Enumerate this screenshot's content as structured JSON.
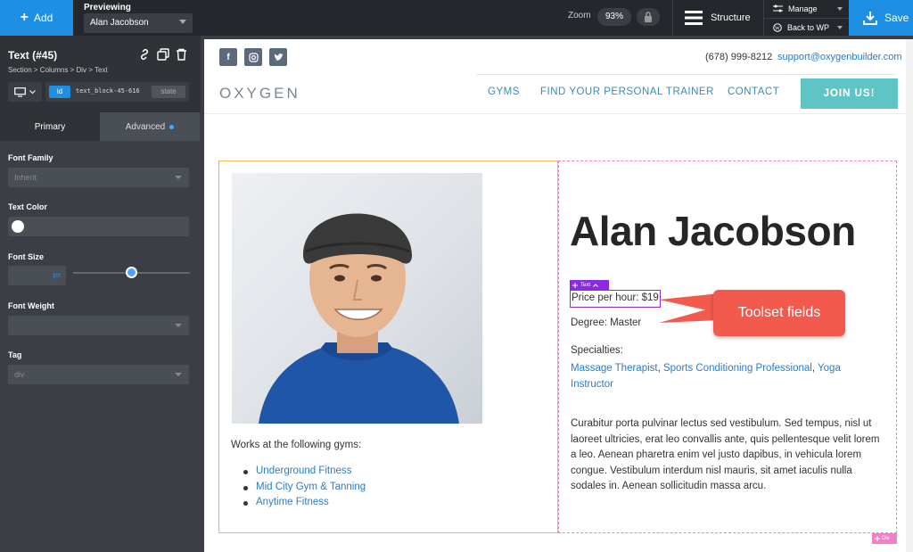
{
  "topbar": {
    "add_label": "Add",
    "previewing_label": "Previewing",
    "previewing_value": "Alan Jacobson",
    "zoom_label": "Zoom",
    "zoom_value": "93%",
    "structure_label": "Structure",
    "manage_label": "Manage",
    "back_label": "Back to WP",
    "save_label": "Save"
  },
  "panel": {
    "element_title": "Text (#45)",
    "breadcrumb": "Section > Columns > Div > Text",
    "id_pill": "id",
    "id_value": "text_block-45-616",
    "state_label": "state",
    "tabs": [
      {
        "label": "Primary"
      },
      {
        "label": "Advanced"
      }
    ],
    "fields": {
      "font_family_label": "Font Family",
      "font_family_value": "Inherit",
      "text_color_label": "Text Color",
      "font_size_label": "Font Size",
      "font_size_unit": "px",
      "font_weight_label": "Font Weight",
      "tag_label": "Tag",
      "tag_value": "div"
    }
  },
  "site": {
    "phone": "(678) 999-8212",
    "email": "support@oxygenbuilder.com",
    "logo": "OXYGEN",
    "nav": [
      "GYMS",
      "FIND YOUR PERSONAL TRAINER",
      "CONTACT"
    ],
    "join_label": "JOIN US!",
    "social": [
      "facebook-icon",
      "instagram-icon",
      "twitter-icon"
    ]
  },
  "profile": {
    "name": "Alan Jacobson",
    "text_tag": "Text",
    "price": "Price per hour: $19",
    "degree": "Degree: Master",
    "specialties_label": "Specialties:",
    "specialties": [
      "Massage Therapist",
      "Sports Conditioning Professional",
      "Yoga Instructor"
    ],
    "bio": "Curabitur porta pulvinar lectus sed vestibulum. Sed tempus, nisl ut laoreet ultricies, erat leo convallis ante, quis pellentesque velit lorem a leo. Aenean pharetra enim vel justo dapibus, in vehicula lorem congue. Vestibulum interdum nisl mauris, sit amet iaculis nulla sodales in. Aenean sollicitudin massa arcu.",
    "gyms_intro": "Works at the following gyms:",
    "gyms": [
      "Underground Fitness",
      "Mid City Gym & Tanning",
      "Anytime Fitness"
    ],
    "div_tag": "Div"
  },
  "callout": {
    "label": "Toolset fields",
    "color": "#f25a4e"
  },
  "colors": {
    "accent": "#1f8fe4",
    "join": "#5ec4c4",
    "link": "#2a7cc7",
    "selection": "#8a2be2",
    "div_outline": "#f080c8"
  }
}
